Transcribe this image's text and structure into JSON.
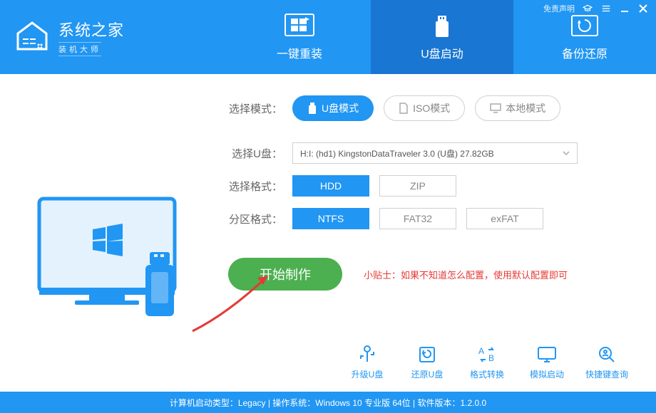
{
  "titlebar": {
    "disclaimer": "免责声明",
    "win_minimize_title": "minimize",
    "win_close_title": "close"
  },
  "logo": {
    "title": "系统之家",
    "subtitle": "装机大师"
  },
  "tabs": {
    "reinstall": "一键重装",
    "usb_boot": "U盘启动",
    "backup": "备份还原"
  },
  "labels": {
    "select_mode": "选择模式：",
    "select_usb": "选择U盘：",
    "select_format": "选择格式：",
    "partition_format": "分区格式："
  },
  "modes": {
    "usb": "U盘模式",
    "iso": "ISO模式",
    "local": "本地模式"
  },
  "usb_selected": "H:I: (hd1) KingstonDataTraveler 3.0 (U盘) 27.82GB",
  "formats": {
    "hdd": "HDD",
    "zip": "ZIP"
  },
  "partitions": {
    "ntfs": "NTFS",
    "fat32": "FAT32",
    "exfat": "exFAT"
  },
  "start_label": "开始制作",
  "tip_text": "小贴士：如果不知道怎么配置，使用默认配置即可",
  "tools": {
    "upgrade_usb": "升级U盘",
    "restore_usb": "还原U盘",
    "format_convert": "格式转换",
    "simulate_boot": "模拟启动",
    "hotkey_lookup": "快捷键查询"
  },
  "statusbar": "计算机启动类型：Legacy | 操作系统：Windows 10 专业版 64位 | 软件版本：1.2.0.0"
}
